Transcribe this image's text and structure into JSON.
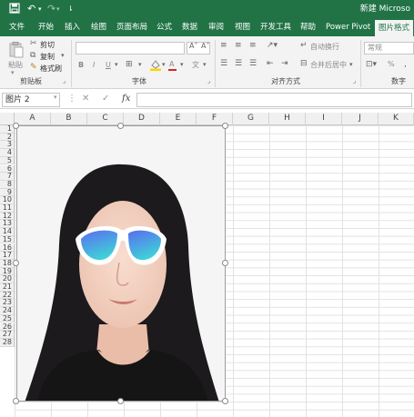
{
  "titlebar": {
    "title": "新建 Microso"
  },
  "tabs": [
    {
      "label": "文件"
    },
    {
      "label": "开始"
    },
    {
      "label": "插入"
    },
    {
      "label": "绘图"
    },
    {
      "label": "页面布局"
    },
    {
      "label": "公式"
    },
    {
      "label": "数据"
    },
    {
      "label": "审阅"
    },
    {
      "label": "视图"
    },
    {
      "label": "开发工具"
    },
    {
      "label": "帮助"
    },
    {
      "label": "Power Pivot"
    },
    {
      "label": "图片格式",
      "active": true
    }
  ],
  "ribbon": {
    "clipboard": {
      "paste": "粘贴",
      "cut": "剪切",
      "copy": "复制",
      "format_painter": "格式刷",
      "group": "剪贴板"
    },
    "font": {
      "group": "字体",
      "bold": "B",
      "italic": "I",
      "underline": "U",
      "font_color_glyph": "A",
      "phonetic_glyph": "文"
    },
    "alignment": {
      "group": "对齐方式",
      "wrap": "自动换行",
      "merge": "合并后居中"
    },
    "number": {
      "group": "数字",
      "format": "常规",
      "percent": "%"
    }
  },
  "formula_bar": {
    "name_box": "图片 2",
    "fx": "fx"
  },
  "columns": [
    "A",
    "B",
    "C",
    "D",
    "E",
    "F",
    "G",
    "H",
    "I",
    "J",
    "K"
  ],
  "rows": [
    "1",
    "2",
    "3",
    "4",
    "5",
    "6",
    "7",
    "8",
    "9",
    "10",
    "11",
    "12",
    "13",
    "14",
    "15",
    "16",
    "17",
    "18",
    "19",
    "20",
    "21",
    "22",
    "23",
    "24",
    "25",
    "26",
    "27",
    "28"
  ],
  "icons": {
    "save": "save-icon",
    "undo": "undo-icon",
    "redo": "redo-icon",
    "sunglasses": "sunglasses-icon"
  },
  "colors": {
    "accent": "#217346",
    "lens_top": "#5b6cf0",
    "lens_bottom": "#3fd0d8"
  }
}
